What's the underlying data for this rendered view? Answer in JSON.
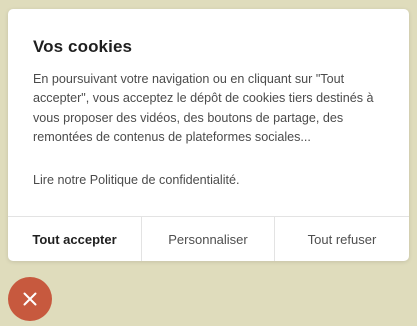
{
  "cookie_modal": {
    "title": "Vos cookies",
    "body": "En poursuivant votre navigation ou en cliquant sur \"Tout accepter\", vous acceptez le dépôt de cookies tiers destinés à vous proposer des vidéos, des boutons de partage, des remontées de contenus de plateformes sociales...",
    "policy_link": "Lire notre Politique de confidentialité.",
    "actions": {
      "accept_all": "Tout accepter",
      "customize": "Personnaliser",
      "refuse_all": "Tout refuser"
    }
  },
  "close_button": {
    "icon": "close-icon",
    "color": "#c7593e"
  },
  "colors": {
    "page_background": "#dfdcbc",
    "modal_background": "#ffffff"
  }
}
